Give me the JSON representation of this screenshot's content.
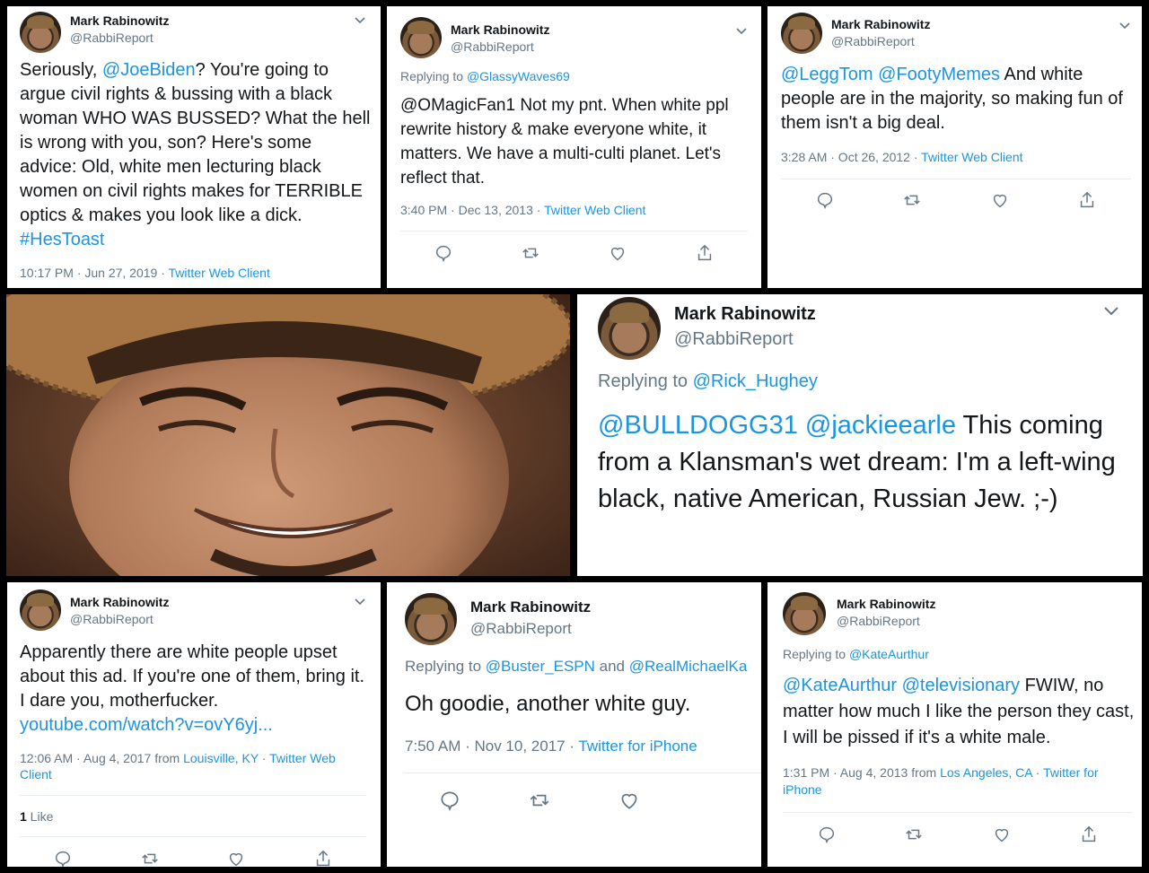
{
  "common": {
    "name": "Mark Rabinowitz",
    "handle": "@RabbiReport"
  },
  "t1": {
    "body_pre": "Seriously, ",
    "mention": "@JoeBiden",
    "body_main": "? You're going to argue civil rights & bussing with a black woman WHO WAS BUSSED? What the hell is wrong with you, son? Here's some advice: Old, white men lecturing black women on civil rights makes for TERRIBLE optics & makes you look like a dick. ",
    "hashtag": "#HesToast",
    "time": "10:17 PM · Jun 27, 2019 · ",
    "client": "Twitter Web Client"
  },
  "t2": {
    "replying_label": "Replying to ",
    "replying_to": "@GlassyWaves69",
    "body": "@OMagicFan1 Not my pnt. When white ppl rewrite history & make everyone white, it matters. We have a multi-culti planet. Let's reflect that.",
    "time": "3:40 PM · Dec 13, 2013 · ",
    "client": "Twitter Web Client"
  },
  "t3": {
    "mention1": "@LeggTom",
    "mention2": "@FootyMemes",
    "body": " And white people are in the majority, so making fun of them isn't a big deal.",
    "time": "3:28 AM · Oct 26, 2012 · ",
    "client": "Twitter Web Client"
  },
  "t4": {
    "replying_label": "Replying to ",
    "replying_to": "@Rick_Hughey",
    "mention1": "@BULLDOGG31",
    "mention2": "@jackieearle",
    "body": " This coming from a Klansman's wet dream: I'm a left-wing black, native American, Russian Jew. ;-)"
  },
  "t5": {
    "body": "Apparently there are white people upset about this ad. If you're one of them, bring it. I dare you, motherfucker.",
    "link": "youtube.com/watch?v=ovY6yj...",
    "time_pre": "12:06 AM · Aug 4, 2017 from ",
    "location": "Louisville, KY",
    "time_mid": " · ",
    "client": "Twitter Web Client",
    "likes_count": "1",
    "likes_label": " Like"
  },
  "t6": {
    "replying_label": "Replying to ",
    "replying_to1": "@Buster_ESPN",
    "and": " and ",
    "replying_to2": "@RealMichaelKa",
    "body": "Oh goodie, another white guy.",
    "time": "7:50 AM · Nov 10, 2017 · ",
    "client": "Twitter for iPhone"
  },
  "t7": {
    "replying_label": "Replying to ",
    "replying_to": "@KateAurthur",
    "mention1": "@KateAurthur",
    "mention2": "@televisionary",
    "body": " FWIW, no matter how much I like the person they cast,  I will be pissed if it's a white male.",
    "time_pre": "1:31 PM · Aug 4, 2013 from ",
    "location": "Los Angeles, CA",
    "time_mid": " · ",
    "client": "Twitter for iPhone"
  },
  "photo": {
    "icon": "portrait-photo"
  }
}
